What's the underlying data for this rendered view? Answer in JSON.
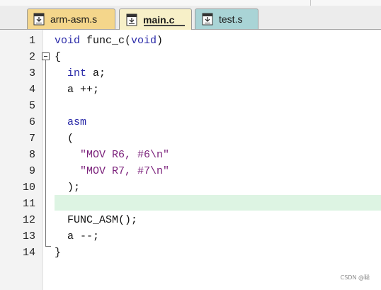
{
  "tabs": [
    {
      "label": "arm-asm.s",
      "icon": "file-icon",
      "color": "#f4d68b"
    },
    {
      "label": "main.c",
      "icon": "file-icon",
      "color": "#f7f0c8",
      "active": true
    },
    {
      "label": "test.s",
      "icon": "file-icon",
      "color": "#a9d4d6"
    }
  ],
  "editor": {
    "highlighted_line": 11,
    "lines": [
      {
        "num": "1",
        "parts": [
          {
            "t": "void",
            "c": "kw"
          },
          {
            "t": " func_c("
          },
          {
            "t": "void",
            "c": "kw"
          },
          {
            "t": ")"
          }
        ]
      },
      {
        "num": "2",
        "parts": [
          {
            "t": "{"
          }
        ]
      },
      {
        "num": "3",
        "parts": [
          {
            "t": "  "
          },
          {
            "t": "int",
            "c": "kw"
          },
          {
            "t": " a;"
          }
        ]
      },
      {
        "num": "4",
        "parts": [
          {
            "t": "  a ++;"
          }
        ]
      },
      {
        "num": "5",
        "parts": [
          {
            "t": ""
          }
        ]
      },
      {
        "num": "6",
        "parts": [
          {
            "t": "  "
          },
          {
            "t": "asm",
            "c": "kw"
          }
        ]
      },
      {
        "num": "7",
        "parts": [
          {
            "t": "  ("
          }
        ]
      },
      {
        "num": "8",
        "parts": [
          {
            "t": "    "
          },
          {
            "t": "\"MOV R6, #6\\n\"",
            "c": "str"
          }
        ]
      },
      {
        "num": "9",
        "parts": [
          {
            "t": "    "
          },
          {
            "t": "\"MOV R7, #7\\n\"",
            "c": "str"
          }
        ]
      },
      {
        "num": "10",
        "parts": [
          {
            "t": "  );"
          }
        ]
      },
      {
        "num": "11",
        "parts": [
          {
            "t": ""
          }
        ]
      },
      {
        "num": "12",
        "parts": [
          {
            "t": "  FUNC_ASM();"
          }
        ]
      },
      {
        "num": "13",
        "parts": [
          {
            "t": "  a --;"
          }
        ]
      },
      {
        "num": "14",
        "parts": [
          {
            "t": "}"
          }
        ]
      }
    ]
  },
  "watermark": "CSDN @聪"
}
